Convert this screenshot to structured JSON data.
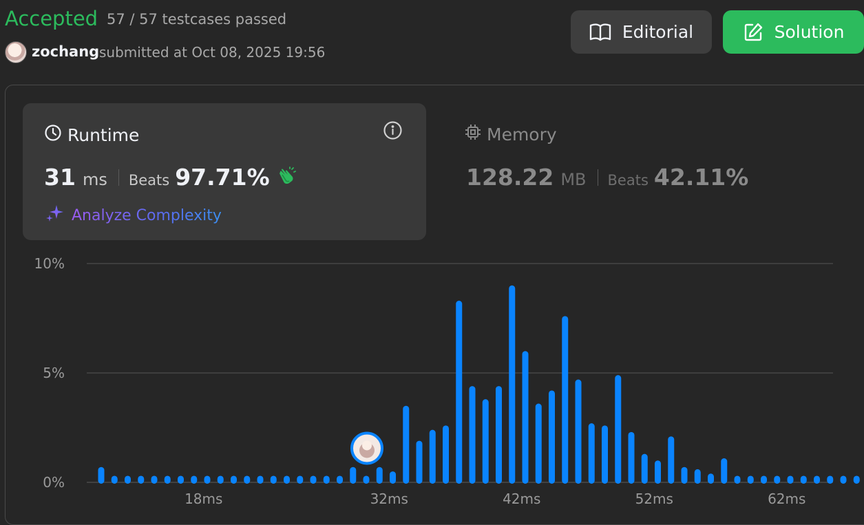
{
  "header": {
    "status": "Accepted",
    "testcases": "57 / 57 testcases passed",
    "username": "zochang",
    "submitted": "submitted at Oct 08, 2025 19:56",
    "editorial_label": "Editorial",
    "solution_label": "Solution"
  },
  "runtime": {
    "title": "Runtime",
    "value": "31",
    "unit": "ms",
    "beats_label": "Beats",
    "beats": "97.71%",
    "analyze_label": "Analyze Complexity"
  },
  "memory": {
    "title": "Memory",
    "value": "128.22",
    "unit": "MB",
    "beats_label": "Beats",
    "beats": "42.11%"
  },
  "colors": {
    "accent_green": "#2cbb5d",
    "bar_blue": "#0a84ff",
    "grid": "#444444"
  },
  "chart_data": {
    "type": "bar",
    "ylabel": "",
    "xlabel": "",
    "ylim": [
      0,
      10
    ],
    "y_ticks": [
      "0%",
      "5%",
      "10%"
    ],
    "x_tick_labels": [
      "18ms",
      "32ms",
      "42ms",
      "52ms",
      "62ms"
    ],
    "x_tick_values": [
      18,
      32,
      42,
      52,
      62
    ],
    "x": [
      11,
      12,
      13,
      14,
      15,
      16,
      17,
      18,
      19,
      20,
      21,
      22,
      23,
      24,
      25,
      26,
      27,
      28,
      29,
      30,
      31,
      32,
      33,
      34,
      35,
      36,
      37,
      38,
      39,
      40,
      41,
      42,
      43,
      44,
      45,
      46,
      47,
      48,
      49,
      50,
      51,
      52,
      53,
      54,
      55,
      56,
      57,
      58,
      59,
      60,
      61,
      62,
      63,
      64,
      65,
      66,
      67,
      68
    ],
    "values": [
      0.7,
      0.3,
      0.3,
      0.3,
      0.3,
      0.3,
      0.3,
      0.3,
      0.3,
      0.3,
      0.3,
      0.3,
      0.3,
      0.3,
      0.3,
      0.3,
      0.3,
      0.3,
      0.3,
      0.7,
      0.3,
      0.7,
      0.5,
      3.5,
      1.9,
      2.4,
      2.6,
      8.3,
      4.4,
      3.8,
      4.4,
      9.0,
      6.0,
      3.6,
      4.2,
      7.6,
      4.7,
      2.7,
      2.6,
      4.9,
      2.3,
      1.3,
      1.0,
      2.1,
      0.7,
      0.6,
      0.4,
      1.1,
      0.3,
      0.3,
      0.3,
      0.3,
      0.3,
      0.3,
      0.3,
      0.3,
      0.3,
      0.3
    ],
    "user_marker_x": 31
  }
}
